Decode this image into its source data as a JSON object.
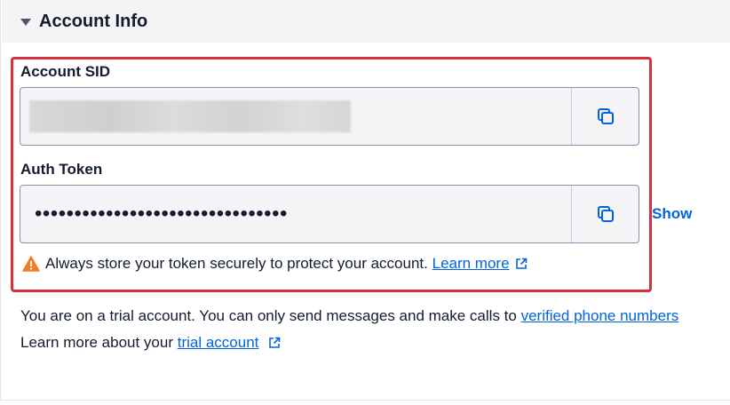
{
  "section": {
    "title": "Account Info"
  },
  "account_sid": {
    "label": "Account SID",
    "value_hidden": true
  },
  "auth_token": {
    "label": "Auth Token",
    "masked_value": "••••••••••••••••••••••••••••••••",
    "show_label": "Show"
  },
  "warning": {
    "text": "Always store your token securely to protect your account.",
    "link_text": "Learn more"
  },
  "trial": {
    "line1_text": "You are on a trial account. You can only send messages and make calls to ",
    "line1_link": "verified phone numbers",
    "line2_text": "Learn more about your ",
    "line2_link": "trial account"
  },
  "colors": {
    "accent": "#0263e0",
    "highlight_border": "#d6303c",
    "warning": "#f47c22"
  }
}
